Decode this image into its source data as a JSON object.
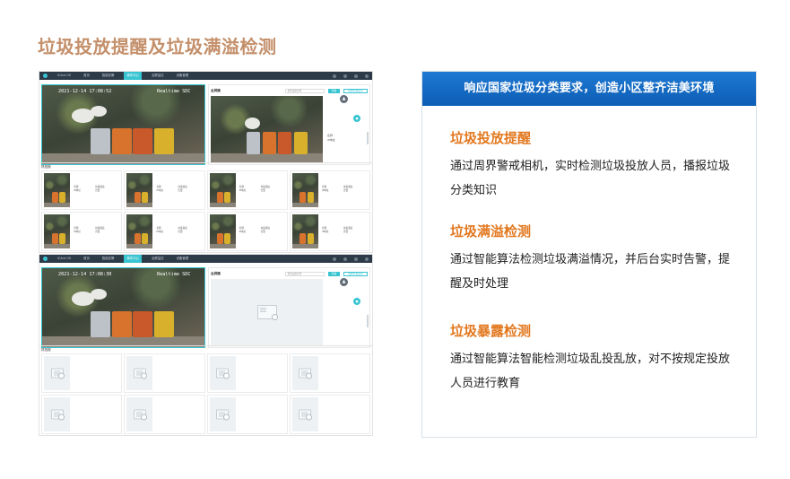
{
  "page": {
    "title": "垃圾投放提醒及垃圾满溢检测"
  },
  "app": {
    "logo_icon": "app-logo-icon",
    "nav": [
      "ICAnt OS",
      "首页",
      "智能告警",
      "事件中心",
      "全屏监控",
      "设备管理"
    ],
    "osd_time_1": "2021-12-14 17:08:52",
    "osd_time_2": "2021-12-14 17:08:30",
    "osd_cam": "Realtime SDC",
    "detail_title": "全屏播",
    "search_placeholder": "搜索设备名称",
    "search_button": "查看",
    "split_button": "切换分屏显示",
    "info_name": "名称",
    "info_ip": "IP地址",
    "events_label": "抓拍报",
    "card_type": "垃圾满溢",
    "card_status": "告警",
    "accent": "#39c4d1"
  },
  "panel": {
    "header": "响应国家垃圾分类要求，创造小区整齐洁美环境",
    "header_color": "#0c5db5",
    "features": [
      {
        "title": "垃圾投放提醒",
        "desc": "通过周界警戒相机，实时检测垃圾投放人员，播报垃圾分类知识"
      },
      {
        "title": "垃圾满溢检测",
        "desc": "通过智能算法检测垃圾满溢情况，并后台实时告警，提醒及时处理"
      },
      {
        "title": "垃圾暴露检测",
        "desc": "通过智能算法智能检测垃圾乱投乱放，对不按规定投放人员进行教育"
      }
    ],
    "title_color": "#e2781f"
  }
}
